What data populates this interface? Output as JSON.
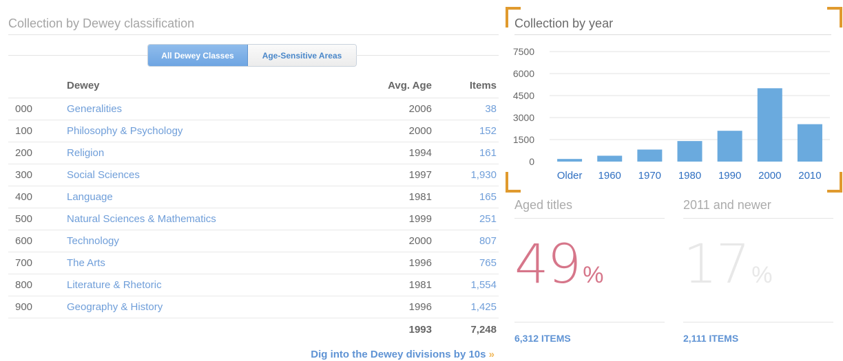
{
  "dewey_panel": {
    "title": "Collection by Dewey classification",
    "toggle": {
      "active": "All Dewey Classes",
      "inactive": "Age-Sensitive Areas"
    },
    "columns": {
      "dewey": "Dewey",
      "avg_age": "Avg. Age",
      "items": "Items"
    },
    "rows": [
      {
        "code": "000",
        "name": "Generalities",
        "avg_age": "2006",
        "items": "38"
      },
      {
        "code": "100",
        "name": "Philosophy & Psychology",
        "avg_age": "2000",
        "items": "152"
      },
      {
        "code": "200",
        "name": "Religion",
        "avg_age": "1994",
        "items": "161"
      },
      {
        "code": "300",
        "name": "Social Sciences",
        "avg_age": "1997",
        "items": "1,930"
      },
      {
        "code": "400",
        "name": "Language",
        "avg_age": "1981",
        "items": "165"
      },
      {
        "code": "500",
        "name": "Natural Sciences & Mathematics",
        "avg_age": "1999",
        "items": "251"
      },
      {
        "code": "600",
        "name": "Technology",
        "avg_age": "2000",
        "items": "807"
      },
      {
        "code": "700",
        "name": "The Arts",
        "avg_age": "1996",
        "items": "765"
      },
      {
        "code": "800",
        "name": "Literature & Rhetoric",
        "avg_age": "1981",
        "items": "1,554"
      },
      {
        "code": "900",
        "name": "Geography & History",
        "avg_age": "1996",
        "items": "1,425"
      }
    ],
    "total": {
      "avg_age": "1993",
      "items": "7,248"
    },
    "dig_link": "Dig into the Dewey divisions by 10s",
    "dig_arrows": "»"
  },
  "chart_data": {
    "type": "bar",
    "title": "Collection by year",
    "categories": [
      "Older",
      "1960",
      "1970",
      "1980",
      "1990",
      "2000",
      "2010"
    ],
    "values": [
      180,
      400,
      820,
      1400,
      2100,
      5000,
      2550
    ],
    "yticks": [
      0,
      1500,
      3000,
      4500,
      6000,
      7500
    ],
    "ylim": [
      0,
      7500
    ],
    "grid": true,
    "bar_color": "#6aaade",
    "tick_color": "#2f6fc1"
  },
  "stats": {
    "aged": {
      "title": "Aged titles",
      "value": "49",
      "unit": "%",
      "items": "6,312 ITEMS",
      "color": "#d6768a"
    },
    "newer": {
      "title": "2011 and newer",
      "value": "17",
      "unit": "%",
      "items": "2,111 ITEMS",
      "color": "#e8e8e8"
    }
  },
  "colors": {
    "highlight": "#e09a2e",
    "link": "#6f9ed9"
  }
}
